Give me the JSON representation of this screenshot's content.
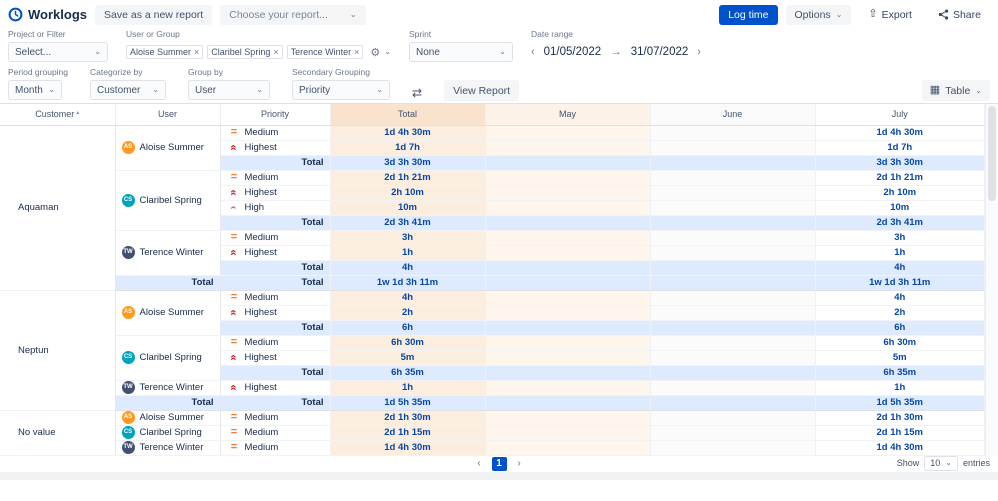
{
  "app": {
    "title": "Worklogs"
  },
  "topbar": {
    "save_button": "Save as a new report",
    "report_placeholder": "Choose your report...",
    "log_time": "Log time",
    "options": "Options",
    "export": "Export",
    "share": "Share"
  },
  "filters": {
    "project": {
      "label": "Project or Filter",
      "value": "Select..."
    },
    "user_group": {
      "label": "User or Group",
      "tags": [
        "Aloise Summer",
        "Claribel Spring",
        "Terence Winter"
      ]
    },
    "sprint": {
      "label": "Sprint",
      "value": "None"
    },
    "date_range": {
      "label": "Date range",
      "from": "01/05/2022",
      "to": "31/07/2022"
    }
  },
  "grouping": {
    "period": {
      "label": "Period grouping",
      "value": "Month"
    },
    "categorize": {
      "label": "Categorize by",
      "value": "Customer"
    },
    "group_by": {
      "label": "Group by",
      "value": "User"
    },
    "secondary": {
      "label": "Secondary Grouping",
      "value": "Priority"
    },
    "view_report": "View Report",
    "view_mode": "Table"
  },
  "table": {
    "columns": [
      "Customer",
      "User",
      "Priority",
      "Total",
      "May",
      "June",
      "July"
    ],
    "rows": [
      {
        "customer": "Aquaman",
        "user": "Aloise Summer",
        "user_initials": "AS",
        "priority": "Medium",
        "total": "1d 4h 30m",
        "july": "1d 4h 30m"
      },
      {
        "priority": "Highest",
        "total": "1d 7h",
        "july": "1d 7h"
      },
      {
        "total_label": "Total",
        "total": "3d 3h 30m",
        "july": "3d 3h 30m"
      },
      {
        "user": "Claribel Spring",
        "user_initials": "CS",
        "priority": "Medium",
        "total": "2d 1h 21m",
        "july": "2d 1h 21m"
      },
      {
        "priority": "Highest",
        "total": "2h 10m",
        "july": "2h 10m"
      },
      {
        "priority": "High",
        "total": "10m",
        "july": "10m"
      },
      {
        "total_label": "Total",
        "total": "2d 3h 41m",
        "july": "2d 3h 41m"
      },
      {
        "user": "Terence Winter",
        "user_initials": "TW",
        "priority": "Medium",
        "total": "3h",
        "july": "3h"
      },
      {
        "priority": "Highest",
        "total": "1h",
        "july": "1h"
      },
      {
        "total_label": "Total",
        "total": "4h",
        "july": "4h"
      },
      {
        "user_total_label": "Total",
        "total_label": "Total",
        "total": "1w 1d 3h 11m",
        "july": "1w 1d 3h 11m"
      },
      {
        "customer": "Neptun",
        "user": "Aloise Summer",
        "user_initials": "AS",
        "priority": "Medium",
        "total": "4h",
        "july": "4h"
      },
      {
        "priority": "Highest",
        "total": "2h",
        "july": "2h"
      },
      {
        "total_label": "Total",
        "total": "6h",
        "july": "6h"
      },
      {
        "user": "Claribel Spring",
        "user_initials": "CS",
        "priority": "Medium",
        "total": "6h 30m",
        "july": "6h 30m"
      },
      {
        "priority": "Highest",
        "total": "5m",
        "july": "5m"
      },
      {
        "total_label": "Total",
        "total": "6h 35m",
        "july": "6h 35m"
      },
      {
        "user": "Terence Winter",
        "user_initials": "TW",
        "priority": "Highest",
        "total": "1h",
        "july": "1h"
      },
      {
        "user_total_label": "Total",
        "total_label": "Total",
        "total": "1d 5h 35m",
        "july": "1d 5h 35m"
      },
      {
        "customer": "No value",
        "user": "Aloise Summer",
        "user_initials": "AS",
        "priority": "Medium",
        "total": "2d 1h 30m",
        "july": "2d 1h 30m"
      },
      {
        "user": "Claribel Spring",
        "user_initials": "CS",
        "priority": "Medium",
        "total": "2d 1h 15m",
        "july": "2d 1h 15m"
      },
      {
        "user": "Terence Winter",
        "user_initials": "TW",
        "priority": "Medium",
        "total": "1d 4h 30m",
        "july": "1d 4h 30m"
      }
    ]
  },
  "footer": {
    "page": "1",
    "show": "Show",
    "per_page": "10",
    "entries": "entries"
  },
  "icons": {
    "chevron_down": "⌄",
    "chevron_left": "‹",
    "chevron_right": "›",
    "arrow_right": "→",
    "close": "×",
    "gear": "⚙",
    "swap": "⇄",
    "table_grid": "▦",
    "export": "⇧",
    "sort_asc": "▴"
  },
  "colors": {
    "primary": "#0052CC",
    "total_column_bg": "#FCEEDF",
    "total_row_bg": "#DEEBFF",
    "value_text": "#0747A6",
    "priority_medium": "#E97F33",
    "priority_high": "#E9494A",
    "priority_highest": "#CD1316",
    "avatar_aloise": "#FF991F",
    "avatar_claribel": "#00A3BF",
    "avatar_terence": "#42526E"
  }
}
